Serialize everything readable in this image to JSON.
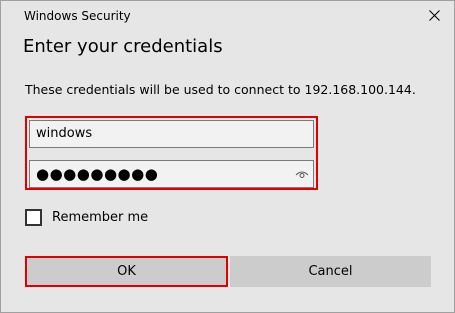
{
  "window": {
    "title": "Windows Security",
    "close_icon": "close-icon"
  },
  "dialog": {
    "heading": "Enter your credentials",
    "description": "These credentials will be used to connect to 192.168.100.144."
  },
  "credentials": {
    "username_value": "windows",
    "password_mask": "●●●●●●●●●",
    "reveal_icon": "eye-icon"
  },
  "remember": {
    "label": "Remember me",
    "checked": false
  },
  "buttons": {
    "ok_label": "OK",
    "cancel_label": "Cancel"
  },
  "colors": {
    "dialog_background": "#e6e6e6",
    "highlight_border": "#e00000",
    "button_background": "#cccccc"
  }
}
